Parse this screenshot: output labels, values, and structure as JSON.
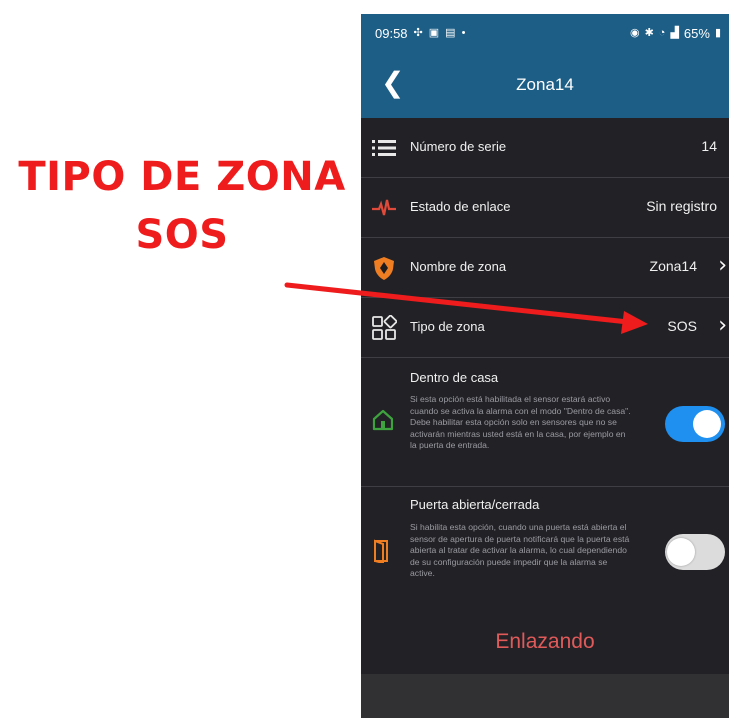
{
  "annotation": {
    "line1": "TIPO DE ZONA",
    "line2": "SOS",
    "color": "#ee1c1c"
  },
  "statusbar": {
    "time": "09:58",
    "battery": "65%",
    "left_icons": [
      "sync-icon",
      "image-icon",
      "cast-icon",
      "dot-icon"
    ],
    "right_icons": [
      "alarm-icon",
      "bluetooth-icon",
      "wifi-icon",
      "signal-icon"
    ]
  },
  "appbar": {
    "title": "Zona14",
    "back_icon": "back-arrow-icon"
  },
  "rows": {
    "serial": {
      "label": "Número de serie",
      "value": "14",
      "icon": "list-icon"
    },
    "link": {
      "label": "Estado de enlace",
      "value": "Sin registro",
      "icon": "pulse-icon"
    },
    "name": {
      "label": "Nombre de zona",
      "value": "Zona14",
      "icon": "shield-icon"
    },
    "type": {
      "label": "Tipo de zona",
      "value": "SOS",
      "icon": "grid-icon"
    }
  },
  "home_mode": {
    "title": "Dentro de casa",
    "description": "Si esta opción está habilitada el sensor estará activo cuando se activa la alarma con el modo \"Dentro de casa\". Debe habilitar esta opción solo en sensores que no se activarán mientras usted está en la casa, por ejemplo en la puerta de entrada.",
    "enabled": true,
    "icon": "home-icon"
  },
  "door": {
    "title": "Puerta abierta/cerrada",
    "description": "Si habilita esta opción, cuando una puerta está abierta el sensor de apertura de puerta notificará que la puerta está abierta al tratar de activar la alarma, lo cual dependiendo de su configuración puede impedir que la alarma se active.",
    "enabled": false,
    "icon": "door-icon"
  },
  "footer": {
    "button_label": "Enlazando"
  },
  "colors": {
    "header": "#1d5e86",
    "background": "#222226",
    "toggle_on": "#1f8ff0",
    "accent_red": "#e05a5a"
  }
}
